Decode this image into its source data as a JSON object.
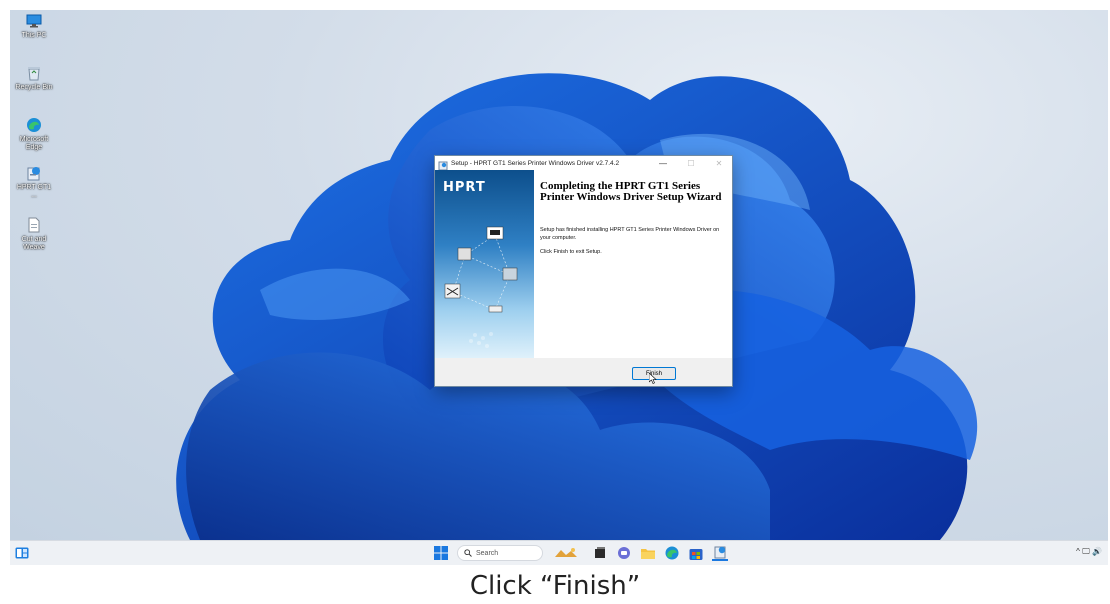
{
  "desktop": {
    "icons": [
      {
        "label": "This PC",
        "icon": "this-pc-icon"
      },
      {
        "label": "Recycle Bin",
        "icon": "recycle-bin-icon"
      },
      {
        "label": "Microsoft Edge",
        "icon": "edge-icon"
      },
      {
        "label": "HPRT GT1 ...",
        "icon": "installer-icon"
      },
      {
        "label": "Cut and Weave",
        "icon": "document-icon"
      }
    ]
  },
  "dialog": {
    "title": "Setup - HPRT GT1 Series Printer Windows Driver v2.7.4.2",
    "logo": "HPRT",
    "heading": "Completing the HPRT GT1 Series Printer Windows Driver Setup Wizard",
    "message1": "Setup has finished installing HPRT GT1 Series Printer Windows Driver on your computer.",
    "message2": "Click Finish to exit Setup.",
    "finish_label": "Finish",
    "window_buttons": {
      "minimize": "—",
      "maximize": "☐",
      "close": "✕"
    }
  },
  "taskbar": {
    "search_placeholder": "Search",
    "tray_text": "^ 🖵 🔊"
  },
  "caption": "Click “Finish”"
}
